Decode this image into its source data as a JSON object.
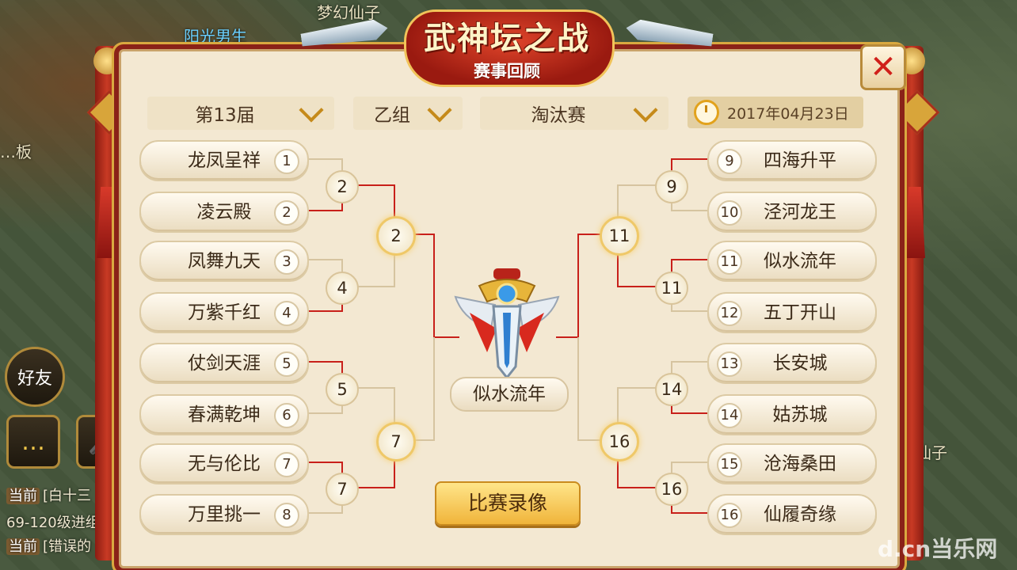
{
  "title": {
    "main": "武神坛之战",
    "sub": "赛事回顾"
  },
  "filters": {
    "season": "第13届",
    "group": "乙组",
    "stage": "淘汰赛",
    "date": "2017年04月23日"
  },
  "left_teams": [
    {
      "name": "龙凤呈祥",
      "seed": "1"
    },
    {
      "name": "凌云殿",
      "seed": "2"
    },
    {
      "name": "凤舞九天",
      "seed": "3"
    },
    {
      "name": "万紫千红",
      "seed": "4"
    },
    {
      "name": "仗剑天涯",
      "seed": "5"
    },
    {
      "name": "春满乾坤",
      "seed": "6"
    },
    {
      "name": "无与伦比",
      "seed": "7"
    },
    {
      "name": "万里挑一",
      "seed": "8"
    }
  ],
  "right_teams": [
    {
      "name": "四海升平",
      "seed": "9"
    },
    {
      "name": "泾河龙王",
      "seed": "10"
    },
    {
      "name": "似水流年",
      "seed": "11"
    },
    {
      "name": "五丁开山",
      "seed": "12"
    },
    {
      "name": "长安城",
      "seed": "13"
    },
    {
      "name": "姑苏城",
      "seed": "14"
    },
    {
      "name": "沧海桑田",
      "seed": "15"
    },
    {
      "name": "仙履奇缘",
      "seed": "16"
    }
  ],
  "left_round1": [
    "2",
    "4",
    "5",
    "7"
  ],
  "left_round2": [
    "2",
    "7"
  ],
  "right_round1": [
    "9",
    "11",
    "14",
    "16"
  ],
  "right_round2": [
    "11",
    "16"
  ],
  "champion": "似水流年",
  "replay_label": "比赛录像",
  "background": {
    "players": [
      "阳光男生",
      "梦幻仙子"
    ],
    "friends_label": "好友",
    "chat": [
      {
        "tag": "当前",
        "text": "[白十三"
      },
      {
        "text": "69-120级进组"
      },
      {
        "tag": "当前",
        "text": "[错误的"
      }
    ],
    "misc": [
      "…板",
      "…仙子"
    ]
  },
  "watermark": "d.cn当乐网",
  "colors": {
    "winner_line": "#c8201a",
    "loser_line": "#d6c4a0",
    "panel": "#f3e8d2"
  }
}
